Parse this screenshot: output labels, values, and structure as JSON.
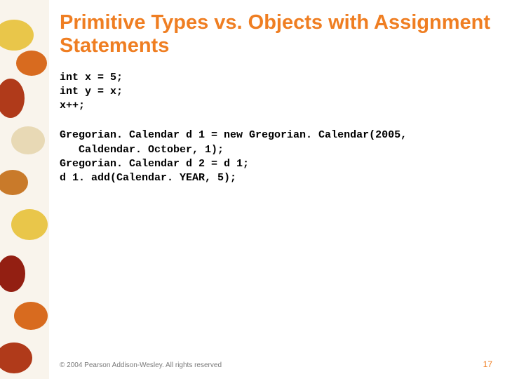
{
  "title": "Primitive Types vs. Objects with Assignment Statements",
  "code1": {
    "l1": "int x = 5;",
    "l2": "int y = x;",
    "l3": "x++;"
  },
  "code2": {
    "l1": "Gregorian. Calendar d 1 = new Gregorian. Calendar(2005,",
    "l2": "   Caldendar. October, 1);",
    "l3": "Gregorian. Calendar d 2 = d 1;",
    "l4": "d 1. add(Calendar. YEAR, 5);"
  },
  "footer": "© 2004 Pearson Addison-Wesley. All rights reserved",
  "page": "17"
}
